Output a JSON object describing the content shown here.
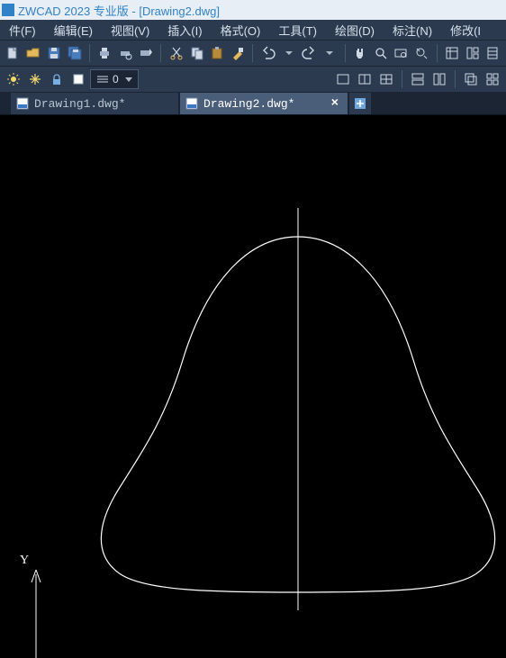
{
  "title": "ZWCAD 2023 专业版 - [Drawing2.dwg]",
  "menu": {
    "file": "件(F)",
    "edit": "编辑(E)",
    "view": "视图(V)",
    "insert": "插入(I)",
    "format": "格式(O)",
    "tools": "工具(T)",
    "draw": "绘图(D)",
    "dim": "标注(N)",
    "modify": "修改(I"
  },
  "toolbar2": {
    "lineweight_value": "0"
  },
  "tabs": {
    "drawing1": "Drawing1.dwg*",
    "drawing2": "Drawing2.dwg*"
  },
  "axis_label_y": "Y"
}
